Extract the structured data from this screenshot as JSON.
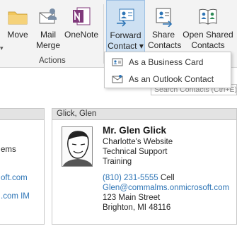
{
  "ribbon": {
    "buttons": {
      "move": "Move",
      "mail_merge": "Mail\nMerge",
      "onenote": "OneNote",
      "forward_contact": "Forward\nContact ▾",
      "share_contacts": "Share\nContacts",
      "open_shared": "Open Shared\nContacts"
    },
    "group_actions": "Actions"
  },
  "search": {
    "placeholder": "Search Contacts (Ctrl+E)"
  },
  "forward_menu": {
    "items": [
      {
        "label": "As a Business Card",
        "icon": "business-card-icon"
      },
      {
        "label": "As an Outlook Contact",
        "icon": "outlook-contact-icon"
      }
    ]
  },
  "left_card_fragments": {
    "line1": "ems",
    "line2": "oft.com",
    "line3": ".com IM"
  },
  "contact_card": {
    "header": "Glick, Glen",
    "name": "Mr. Glen Glick",
    "company": "Charlotte's Website",
    "department": "Technical Support",
    "job": "Training",
    "phone": "(810) 231-5555",
    "phone_type": "Cell",
    "email": "Glen@commalms.onmicrosoft.com",
    "street": "123 Main Street",
    "city": "Brighton, MI 48116"
  },
  "colors": {
    "accent": "#2e75b6",
    "selected": "#cde0f2",
    "ribbon": "#f3f3f3"
  }
}
